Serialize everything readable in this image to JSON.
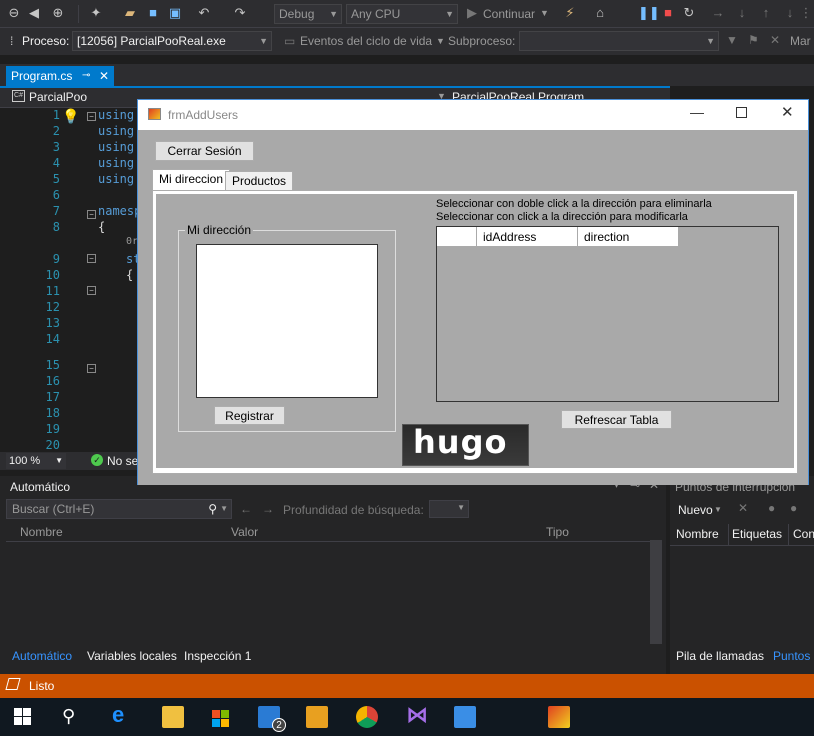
{
  "toolbar": {
    "config": "Debug",
    "platform": "Any CPU",
    "continue_label": "Continuar"
  },
  "toolbar2": {
    "process_label": "Proceso:",
    "process_value": "[12056] ParcialPooReal.exe",
    "lifecycle_label": "Eventos del ciclo de vida",
    "subprocess_label": "Subproceso:",
    "mar_label": "Mar"
  },
  "editor": {
    "tab_name": "Program.cs",
    "project": "ParcialPoo",
    "nav_right": "ParcialPooReal.Program",
    "line_numbers": [
      "1",
      "2",
      "3",
      "4",
      "5",
      "6",
      "7",
      "8",
      "",
      "9",
      "10",
      "11",
      "12",
      "13",
      "14",
      "",
      "15",
      "16",
      "17",
      "18",
      "19",
      "20"
    ],
    "code_lines": [
      "using",
      "using",
      "using",
      "using",
      "using",
      "",
      "namesp",
      "{",
      "0r",
      "st",
      "{"
    ],
    "zoom": "100 %",
    "status_text": "No se"
  },
  "auto_panel": {
    "title": "Automático",
    "search_placeholder": "Buscar (Ctrl+E)",
    "depth_label": "Profundidad de búsqueda:",
    "col_name": "Nombre",
    "col_value": "Valor",
    "col_type": "Tipo",
    "bottom_tabs": [
      "Automático",
      "Variables locales",
      "Inspección 1"
    ]
  },
  "breakpoints_panel": {
    "title": "Puntos de interrupción",
    "new_label": "Nuevo",
    "col_name": "Nombre",
    "col_labels": "Etiquetas",
    "col_cond": "Con",
    "bottom_tabs": [
      "Pila de llamadas",
      "Puntos"
    ]
  },
  "status_bar": {
    "text": "Listo"
  },
  "taskbar": {
    "mail_badge": "2"
  },
  "form": {
    "title": "frmAddUsers",
    "logout_button": "Cerrar Sesión",
    "tabs": [
      "Mi direccion",
      "Productos"
    ],
    "group_title": "Mi dirección",
    "register_button": "Registrar",
    "hint1": "Seleccionar con doble click a la dirección para eliminarla",
    "hint2": "Seleccionar con click a la dirección para modificarla",
    "grid_columns": [
      "idAddress",
      "direction"
    ],
    "refresh_button": "Refrescar Tabla",
    "logo_text": "hugo"
  }
}
